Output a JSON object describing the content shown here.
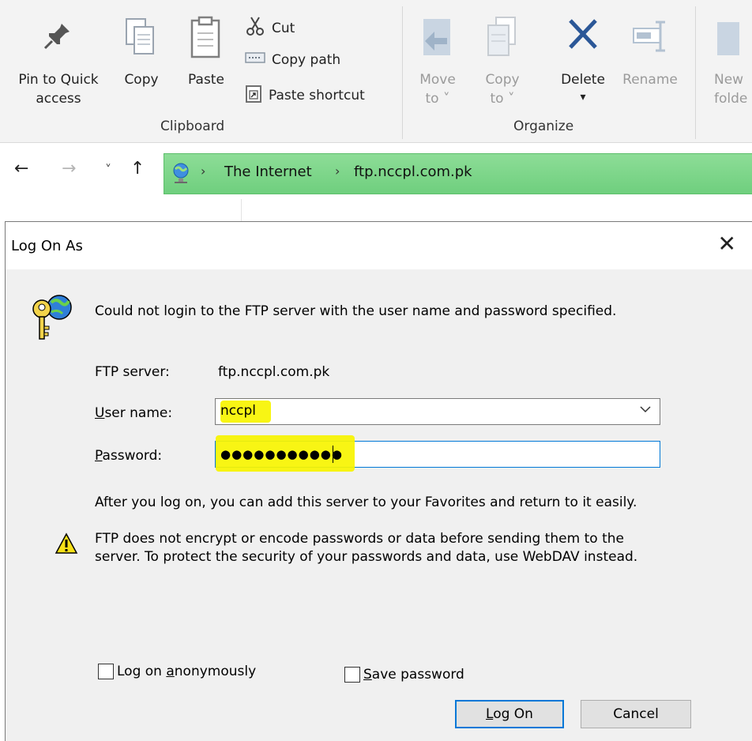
{
  "ribbon": {
    "pin_line1": "Pin to Quick",
    "pin_line2": "access",
    "copy": "Copy",
    "paste": "Paste",
    "cut": "Cut",
    "copy_path": "Copy path",
    "paste_shortcut": "Paste shortcut",
    "clipboard_group": "Clipboard",
    "move_line1": "Move",
    "move_line2": "to ˅",
    "copyto_line1": "Copy",
    "copyto_line2": "to ˅",
    "delete": "Delete",
    "delete_arrow": "▾",
    "rename": "Rename",
    "new_line1": "New",
    "new_line2": "folde",
    "organize_group": "Organize"
  },
  "nav": {
    "back": "←",
    "forward": "→",
    "recent": "˅",
    "up": "↑",
    "sep": "›",
    "crumbs": [
      "The Internet",
      "ftp.nccpl.com.pk"
    ]
  },
  "dialog": {
    "title": "Log On As",
    "close": "✕",
    "message": "Could not login to the FTP server with the user name and password specified.",
    "ftp_server_label": "FTP server:",
    "ftp_server_value": "ftp.nccpl.com.pk",
    "username_label_prefix": "U",
    "username_label_rest": "ser name:",
    "username_value": "nccpl",
    "password_label_prefix": "P",
    "password_label_rest": "assword:",
    "password_value": "●●●●●●●●●●●",
    "favorites_note": "After you log on, you can add this server to your Favorites and return to it easily.",
    "warning_line1": "FTP does not encrypt or encode passwords or data before sending them to the",
    "warning_line2": "server.  To protect the security of your passwords and data, use WebDAV instead.",
    "anon_prefix": "Log on ",
    "anon_ul": "a",
    "anon_rest": "nonymously",
    "save_ul": "S",
    "save_rest": "ave password",
    "logon_ul": "L",
    "logon_rest": "og On",
    "cancel": "Cancel"
  },
  "colors": {
    "address_bar": "#7dd68a",
    "highlight": "#f7f400",
    "focus_border": "#0078d7"
  },
  "icons": [
    "pin-icon",
    "copy-icon",
    "paste-icon",
    "scissors-icon",
    "copy-path-icon",
    "paste-shortcut-icon",
    "move-to-icon",
    "copy-to-icon",
    "delete-icon",
    "rename-icon",
    "new-folder-icon",
    "network-location-icon",
    "keys-globe-icon",
    "warning-icon"
  ]
}
